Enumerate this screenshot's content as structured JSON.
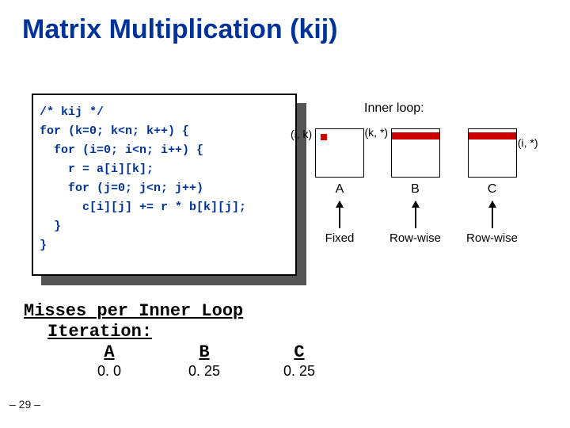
{
  "title": "Matrix Multiplication (kij)",
  "code": "/* kij */\nfor (k=0; k<n; k++) {\n  for (i=0; i<n; i++) {\n    r = a[i][k];\n    for (j=0; j<n; j++)\n      c[i][j] += r * b[k][j];\n  }\n}",
  "inner_loop_label": "Inner loop:",
  "matrices": {
    "A": {
      "name": "A",
      "index": "(i, k)",
      "access": "Fixed",
      "pattern": "fixed"
    },
    "B": {
      "name": "B",
      "index": "(k, *)",
      "access": "Row-wise",
      "pattern": "row"
    },
    "C": {
      "name": "C",
      "index": "(i, *)",
      "access": "Row-wise",
      "pattern": "row"
    }
  },
  "misses": {
    "heading1": "Misses per Inner Loop",
    "heading2": "Iteration:",
    "cols": {
      "A": "A",
      "B": "B",
      "C": "C"
    },
    "vals": {
      "A": "0. 0",
      "B": "0. 25",
      "C": "0. 25"
    }
  },
  "chart_data": {
    "type": "table",
    "title": "Misses per Inner Loop Iteration",
    "categories": [
      "A",
      "B",
      "C"
    ],
    "values": [
      0.0,
      0.25,
      0.25
    ]
  },
  "slide_number": "– 29 –"
}
